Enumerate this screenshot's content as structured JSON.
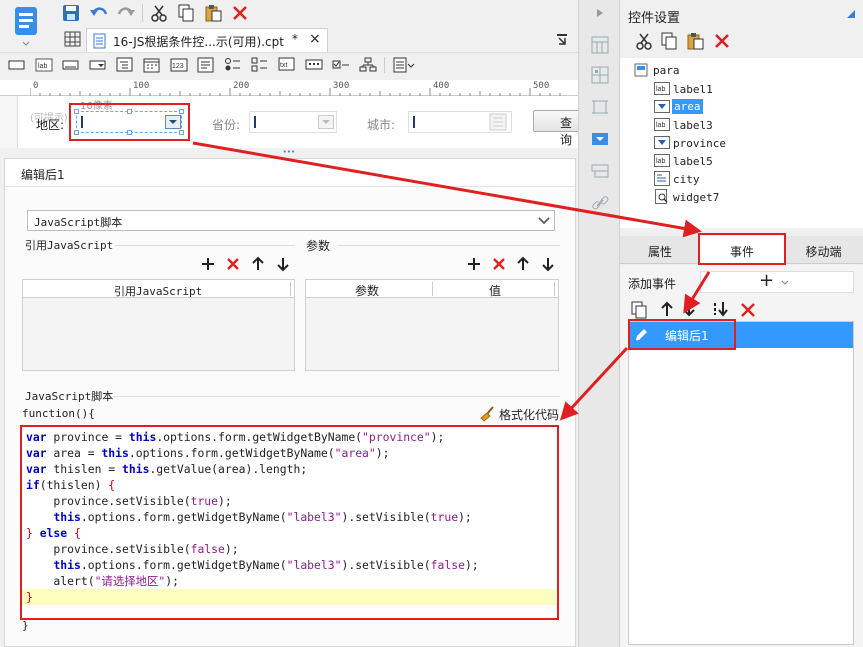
{
  "top_toolbar": {
    "tab_title": "16-JS根据条件控...示(可用).cpt",
    "tab_modified": "*",
    "tab_close": "×"
  },
  "ruler": {
    "ticks": [
      "0",
      "100",
      "200",
      "300",
      "400",
      "500"
    ],
    "hint": "16像素"
  },
  "form_preview": {
    "area_label": "地区:",
    "province_label": "省份:",
    "city_label": "城市:",
    "query_button": "查询",
    "ghost_label": "(可提示)"
  },
  "splitter_dots": "•••",
  "editor": {
    "title": "编辑后1",
    "script_type": "JavaScript脚本",
    "ref_section_title": "引用JavaScript",
    "param_section_title": "参数",
    "ref_col_header": "引用JavaScript",
    "param_col_header": "参数",
    "value_col_header": "值",
    "js_section_title": "JavaScript脚本",
    "function_header": "function(){",
    "format_button": "格式化代码",
    "closing_brace": "}",
    "code_lines": [
      "var province = this.options.form.getWidgetByName(\"province\");",
      "var area = this.options.form.getWidgetByName(\"area\");",
      "var thislen = this.getValue(area).length;",
      "if(thislen) {",
      "    province.setVisible(true);",
      "    this.options.form.getWidgetByName(\"label3\").setVisible(true);",
      "} else {",
      "    province.setVisible(false);",
      "    this.options.form.getWidgetByName(\"label3\").setVisible(false);",
      "    alert(\"请选择地区\");",
      "}"
    ]
  },
  "right_panel": {
    "title": "控件设置",
    "tree_root": "para",
    "tree_items": [
      {
        "label": "label1",
        "icon": "label-icon",
        "selected": false
      },
      {
        "label": "area",
        "icon": "combo-icon",
        "selected": true
      },
      {
        "label": "label3",
        "icon": "label-icon",
        "selected": false
      },
      {
        "label": "province",
        "icon": "combo-icon",
        "selected": false
      },
      {
        "label": "label5",
        "icon": "label-icon",
        "selected": false
      },
      {
        "label": "city",
        "icon": "tree-combo-icon",
        "selected": false
      },
      {
        "label": "widget7",
        "icon": "query-icon",
        "selected": false
      }
    ],
    "tabs": [
      "属性",
      "事件",
      "移动端"
    ],
    "active_tab": "事件",
    "add_event_label": "添加事件",
    "add_button": "+",
    "event_items": [
      "编辑后1"
    ]
  },
  "colors": {
    "accent": "#3399ff",
    "annotation": "#e02020",
    "selected_bg": "#3a8ee6"
  }
}
